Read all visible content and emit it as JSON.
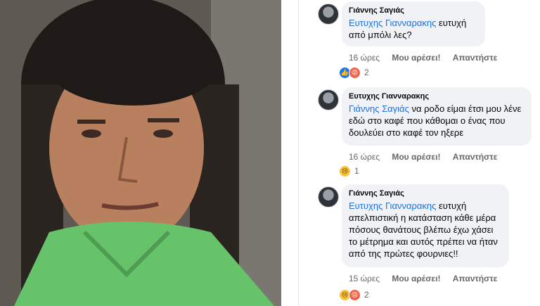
{
  "photo": {
    "alt_icon": "person-photo"
  },
  "comments": [
    {
      "author": "Γιάννης Σαγιάς",
      "mention": "Ευτυχης Γιανναρακης",
      "text": " ευτυχή  από μπόλι  λες?",
      "time": "16 ώρες",
      "like_label": "Μου αρέσει!",
      "reply_label": "Απαντήστε",
      "reactions": [
        "like",
        "angry"
      ],
      "reaction_count": "2"
    },
    {
      "author": "Ευτυχης Γιανναρακης",
      "mention": "Γιάννης Σαγιάς",
      "text": " να ροδο είμαι έτσι μου λένε εδώ στο καφέ που κάθομαι ο ένας που δουλεύει στο καφέ τον ηξερε",
      "time": "16 ώρες",
      "like_label": "Μου αρέσει!",
      "reply_label": "Απαντήστε",
      "reactions": [
        "sad"
      ],
      "reaction_count": "1"
    },
    {
      "author": "Γιάννης Σαγιάς",
      "mention": "Ευτυχης Γιανναρακης",
      "text": " ευτυχή απελπιστική η κατάσταση κάθε μέρα πόσους θανάτους βλέπω έχω χάσει το μέτρημα  και  αυτός πρέπει να ήταν από της  πρώτες  φουρνιες!!",
      "time": "15 ώρες",
      "like_label": "Μου αρέσει!",
      "reply_label": "Απαντήστε",
      "reactions": [
        "sad",
        "angry"
      ],
      "reaction_count": "2"
    }
  ]
}
